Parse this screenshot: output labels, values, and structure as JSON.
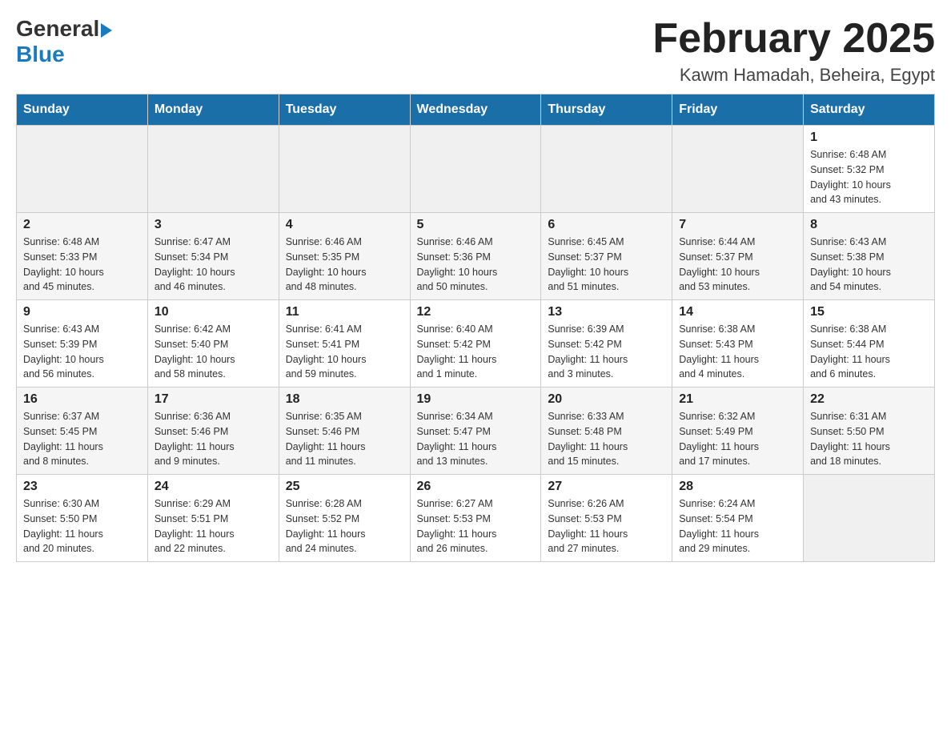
{
  "header": {
    "logo": {
      "general": "General",
      "blue": "Blue"
    },
    "title": "February 2025",
    "location": "Kawm Hamadah, Beheira, Egypt"
  },
  "weekdays": [
    "Sunday",
    "Monday",
    "Tuesday",
    "Wednesday",
    "Thursday",
    "Friday",
    "Saturday"
  ],
  "weeks": [
    [
      {
        "day": "",
        "info": ""
      },
      {
        "day": "",
        "info": ""
      },
      {
        "day": "",
        "info": ""
      },
      {
        "day": "",
        "info": ""
      },
      {
        "day": "",
        "info": ""
      },
      {
        "day": "",
        "info": ""
      },
      {
        "day": "1",
        "info": "Sunrise: 6:48 AM\nSunset: 5:32 PM\nDaylight: 10 hours\nand 43 minutes."
      }
    ],
    [
      {
        "day": "2",
        "info": "Sunrise: 6:48 AM\nSunset: 5:33 PM\nDaylight: 10 hours\nand 45 minutes."
      },
      {
        "day": "3",
        "info": "Sunrise: 6:47 AM\nSunset: 5:34 PM\nDaylight: 10 hours\nand 46 minutes."
      },
      {
        "day": "4",
        "info": "Sunrise: 6:46 AM\nSunset: 5:35 PM\nDaylight: 10 hours\nand 48 minutes."
      },
      {
        "day": "5",
        "info": "Sunrise: 6:46 AM\nSunset: 5:36 PM\nDaylight: 10 hours\nand 50 minutes."
      },
      {
        "day": "6",
        "info": "Sunrise: 6:45 AM\nSunset: 5:37 PM\nDaylight: 10 hours\nand 51 minutes."
      },
      {
        "day": "7",
        "info": "Sunrise: 6:44 AM\nSunset: 5:37 PM\nDaylight: 10 hours\nand 53 minutes."
      },
      {
        "day": "8",
        "info": "Sunrise: 6:43 AM\nSunset: 5:38 PM\nDaylight: 10 hours\nand 54 minutes."
      }
    ],
    [
      {
        "day": "9",
        "info": "Sunrise: 6:43 AM\nSunset: 5:39 PM\nDaylight: 10 hours\nand 56 minutes."
      },
      {
        "day": "10",
        "info": "Sunrise: 6:42 AM\nSunset: 5:40 PM\nDaylight: 10 hours\nand 58 minutes."
      },
      {
        "day": "11",
        "info": "Sunrise: 6:41 AM\nSunset: 5:41 PM\nDaylight: 10 hours\nand 59 minutes."
      },
      {
        "day": "12",
        "info": "Sunrise: 6:40 AM\nSunset: 5:42 PM\nDaylight: 11 hours\nand 1 minute."
      },
      {
        "day": "13",
        "info": "Sunrise: 6:39 AM\nSunset: 5:42 PM\nDaylight: 11 hours\nand 3 minutes."
      },
      {
        "day": "14",
        "info": "Sunrise: 6:38 AM\nSunset: 5:43 PM\nDaylight: 11 hours\nand 4 minutes."
      },
      {
        "day": "15",
        "info": "Sunrise: 6:38 AM\nSunset: 5:44 PM\nDaylight: 11 hours\nand 6 minutes."
      }
    ],
    [
      {
        "day": "16",
        "info": "Sunrise: 6:37 AM\nSunset: 5:45 PM\nDaylight: 11 hours\nand 8 minutes."
      },
      {
        "day": "17",
        "info": "Sunrise: 6:36 AM\nSunset: 5:46 PM\nDaylight: 11 hours\nand 9 minutes."
      },
      {
        "day": "18",
        "info": "Sunrise: 6:35 AM\nSunset: 5:46 PM\nDaylight: 11 hours\nand 11 minutes."
      },
      {
        "day": "19",
        "info": "Sunrise: 6:34 AM\nSunset: 5:47 PM\nDaylight: 11 hours\nand 13 minutes."
      },
      {
        "day": "20",
        "info": "Sunrise: 6:33 AM\nSunset: 5:48 PM\nDaylight: 11 hours\nand 15 minutes."
      },
      {
        "day": "21",
        "info": "Sunrise: 6:32 AM\nSunset: 5:49 PM\nDaylight: 11 hours\nand 17 minutes."
      },
      {
        "day": "22",
        "info": "Sunrise: 6:31 AM\nSunset: 5:50 PM\nDaylight: 11 hours\nand 18 minutes."
      }
    ],
    [
      {
        "day": "23",
        "info": "Sunrise: 6:30 AM\nSunset: 5:50 PM\nDaylight: 11 hours\nand 20 minutes."
      },
      {
        "day": "24",
        "info": "Sunrise: 6:29 AM\nSunset: 5:51 PM\nDaylight: 11 hours\nand 22 minutes."
      },
      {
        "day": "25",
        "info": "Sunrise: 6:28 AM\nSunset: 5:52 PM\nDaylight: 11 hours\nand 24 minutes."
      },
      {
        "day": "26",
        "info": "Sunrise: 6:27 AM\nSunset: 5:53 PM\nDaylight: 11 hours\nand 26 minutes."
      },
      {
        "day": "27",
        "info": "Sunrise: 6:26 AM\nSunset: 5:53 PM\nDaylight: 11 hours\nand 27 minutes."
      },
      {
        "day": "28",
        "info": "Sunrise: 6:24 AM\nSunset: 5:54 PM\nDaylight: 11 hours\nand 29 minutes."
      },
      {
        "day": "",
        "info": ""
      }
    ]
  ]
}
